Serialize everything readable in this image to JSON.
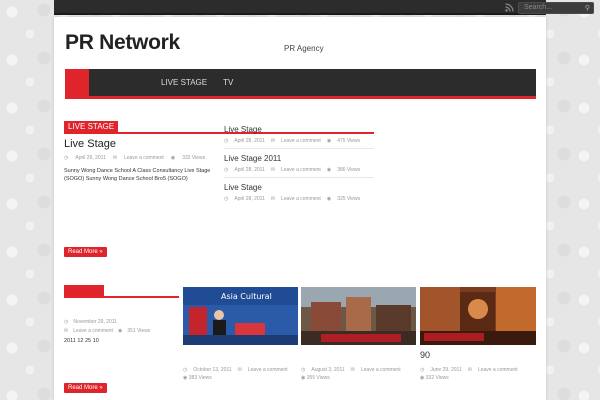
{
  "topbar": {
    "search_placeholder": "Search..."
  },
  "site": {
    "title": "PR Network",
    "tagline": "PR Agency"
  },
  "nav": {
    "items": [
      {
        "label": ""
      },
      {
        "label": ""
      },
      {
        "label": ""
      },
      {
        "label": "LIVE STAGE"
      },
      {
        "label": "TV"
      },
      {
        "label": ""
      },
      {
        "label": ""
      }
    ]
  },
  "colors": {
    "accent": "#e0242c",
    "nav_bg": "#2c2c2c",
    "topbar_bg": "#2c2c2c"
  },
  "section1": {
    "label": "LIVE STAGE",
    "feature": {
      "title": "Live Stage",
      "date": "April 29, 2011",
      "comments": "Leave a comment",
      "views": "332 Views",
      "excerpt": "Sunny Wong Dance School A Class Consultancy Live Stage (SOGO) Sunny Wong Dance School Bro5 (SOGO)",
      "more": "Read More »"
    },
    "list": [
      {
        "title": "Live Stage",
        "date": "April 28, 2011",
        "comments": "Leave a comment",
        "views": "475 Views"
      },
      {
        "title": "Live Stage 2011",
        "date": "April 28, 2011",
        "comments": "Leave a comment",
        "views": "386 Views"
      },
      {
        "title": "Live Stage",
        "date": "April 28, 2011",
        "comments": "Leave a comment",
        "views": "325 Views"
      }
    ]
  },
  "section2": {
    "label": "",
    "feature": {
      "title": "",
      "date": "November 29, 2011",
      "comments": "Leave a comment",
      "views": "351 Views",
      "excerpt": "2011 12 25 10",
      "more": "Read More »"
    },
    "thumbs": [
      {
        "title": "",
        "date": "October 13, 2011",
        "comments": "Leave a comment",
        "views": "383 Views",
        "image_caption": "Asia Cultural"
      },
      {
        "title": "",
        "date": "August 3, 2011",
        "comments": "Leave a comment",
        "views": "355 Views",
        "image_caption": ""
      },
      {
        "title": "90",
        "date": "June 29, 2011",
        "comments": "Leave a comment",
        "views": "332 Views",
        "image_caption": ""
      }
    ]
  }
}
